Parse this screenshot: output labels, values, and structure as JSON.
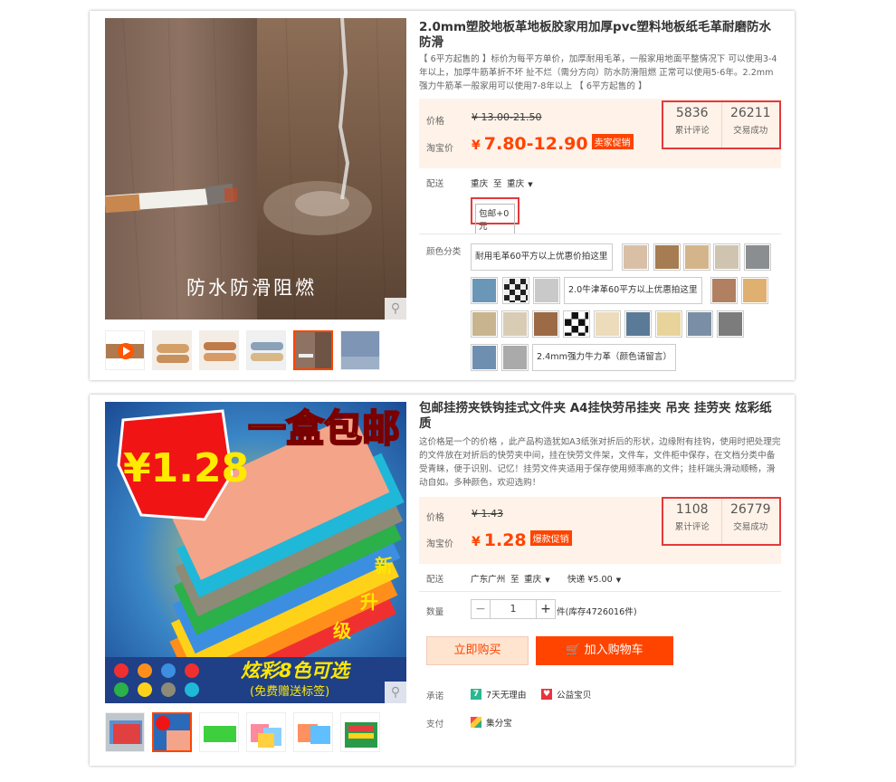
{
  "products": [
    {
      "title": "2.0mm塑胶地板革地板胶家用加厚pvc塑料地板纸毛革耐磨防水防滑",
      "desc": "【 6平方起售的 】标价为每平方单价，加厚耐用毛革，一般家用地面平整情况下 可以使用3-4年以上，加厚牛筋革折不坏 扯不烂（需分方向）防水防滑阻燃 正常可以使用5-6年。2.2mm强力牛筋革一般家用可以使用7-8年以上 【 6平方起售的 】",
      "image_caption": "防水防滑阻燃",
      "price_label": "价格",
      "old_price": "¥ 13.00-21.50",
      "taobao_label": "淘宝价",
      "yen": "¥",
      "price": "7.80-12.90",
      "promo": "卖家促销",
      "reviews": "5836",
      "reviews_label": "累计评论",
      "sales": "26211",
      "sales_label": "交易成功",
      "ship_label": "配送",
      "ship_from": "重庆",
      "ship_to_word": "至",
      "ship_to": "重庆",
      "ship_fee": "包邮+0元",
      "color_label": "颜色分类",
      "options": [
        "耐用毛革60平方以上优惠价拍这里",
        "2.0牛津革60平方以上优惠拍这里",
        "2.4mm强力牛力革（颜色请留言）"
      ]
    },
    {
      "title": "包邮挂捞夹铁钩挂式文件夹 A4挂快劳吊挂夹 吊夹 挂劳夹 炫彩纸质",
      "desc": "这价格是一个的价格 ，此产品构造犹如A3纸张对折后的形状，边缘附有挂钩，使用时把处理完的文件放在对折后的快劳夹中间，挂在快劳文件架，文件车，文件柜中保存，在文档分类中备受青睐，便于识别、记忆！挂劳文件夹适用于保存使用频率高的文件；挂杆端头滑动顺畅，滑动自如。多种颜色，欢迎选购！",
      "image_text_main": "一盒包邮",
      "image_text_price": "¥1.28",
      "image_text_new": "新",
      "image_text_upgrade1": "升",
      "image_text_upgrade2": "级",
      "image_text_colors": "炫彩8色可选",
      "image_text_gift": "(免费赠送标签)",
      "price_label": "价格",
      "old_price": "¥ 1.43",
      "taobao_label": "淘宝价",
      "yen": "¥",
      "price": "1.28",
      "promo": "爆款促销",
      "reviews": "1108",
      "reviews_label": "累计评论",
      "sales": "26779",
      "sales_label": "交易成功",
      "ship_label": "配送",
      "ship_from": "广东广州",
      "ship_to_word": "至",
      "ship_to": "重庆",
      "ship_method": "快递 ¥5.00",
      "qty_label": "数量",
      "qty_minus": "−",
      "qty_value": "1",
      "qty_plus": "+",
      "stock": "件(库存4726016件)",
      "buy_now": "立即购买",
      "cart_icon": "🛒",
      "add_cart": "加入购物车",
      "promise_label": "承诺",
      "promise_7day_icon": "7",
      "promise_7day": "7天无理由",
      "promise_charity": "公益宝贝",
      "pay_label": "支付",
      "pay_method": "集分宝"
    }
  ],
  "icons": {
    "zoom": "search-icon",
    "play": "play-icon"
  },
  "colors": {
    "accent": "#ff4400",
    "price_bg": "#fff2e8",
    "highlight_border": "#e4393c"
  }
}
